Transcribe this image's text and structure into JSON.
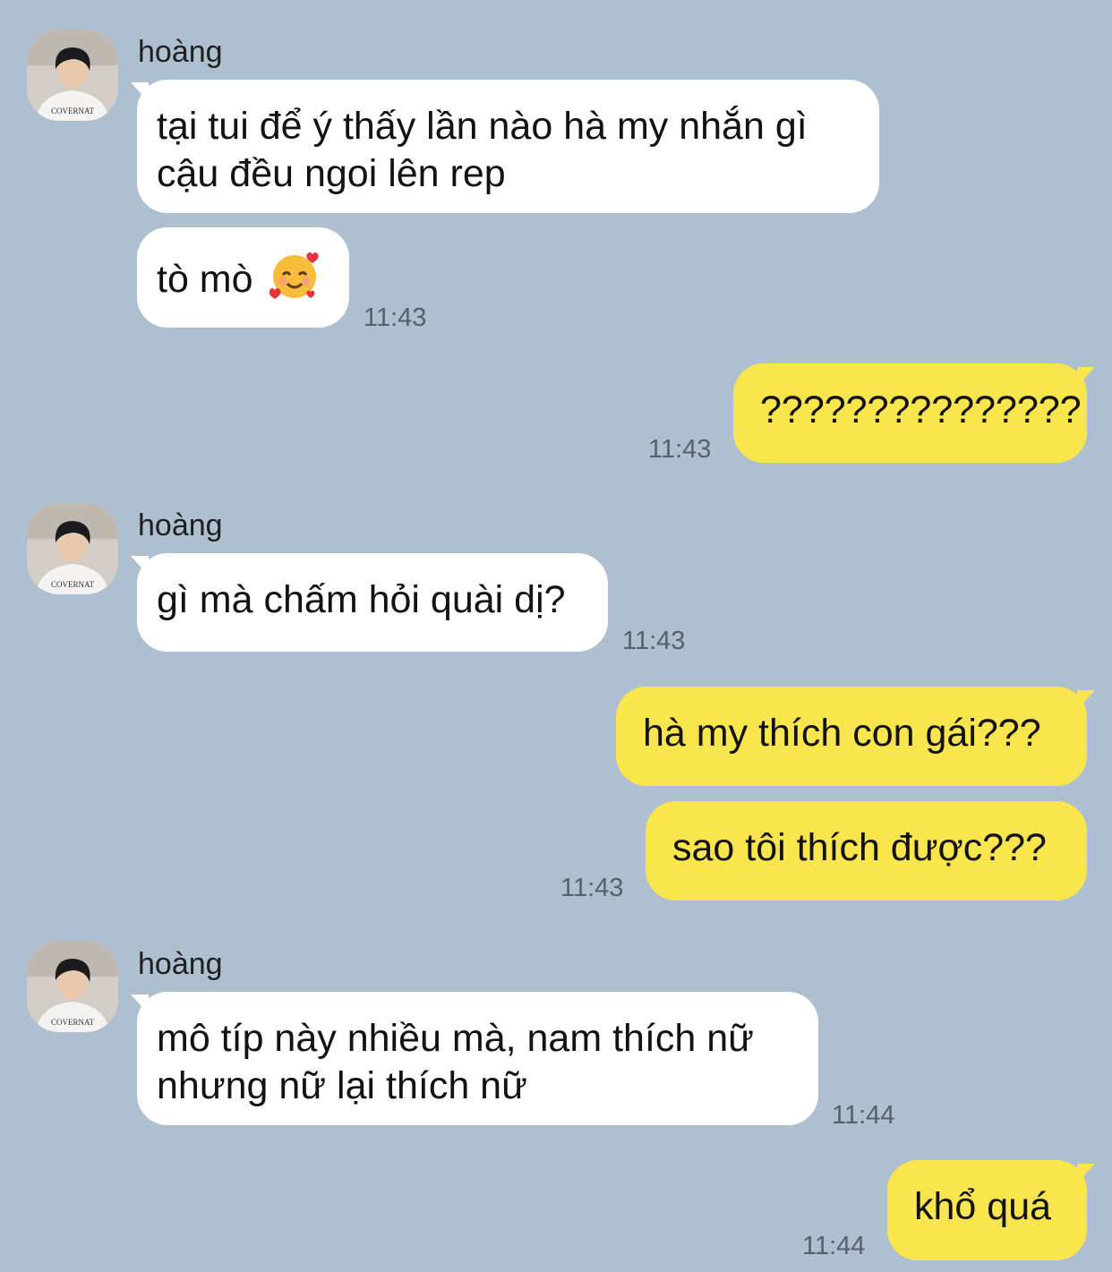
{
  "chat": {
    "sender_name": "hoàng",
    "avatar_shirt_text": "COVERNAT",
    "messages": [
      {
        "lines": [
          "tại tui để ý thấy lần nào hà my nhắn gì",
          "cậu đều ngoi lên rep"
        ]
      },
      {
        "text": "tò mò",
        "emoji": "smiling-face-with-hearts-emoji",
        "time": "11:43"
      },
      {
        "text": "???????????????",
        "time": "11:43"
      },
      {
        "text": "gì mà chấm hỏi quài dị?",
        "time": "11:43"
      },
      {
        "text": "hà my thích con gái???"
      },
      {
        "text": "sao tôi thích được???",
        "time": "11:43"
      },
      {
        "lines": [
          "mô típ này nhiều mà, nam thích nữ",
          "nhưng nữ lại thích nữ"
        ],
        "time": "11:44"
      },
      {
        "text": "khổ quá",
        "time": "11:44"
      }
    ]
  },
  "colors": {
    "background": "#aebfcf",
    "incoming_bubble": "#ffffff",
    "outgoing_bubble": "#f9e54e",
    "timestamp": "#55606b"
  }
}
